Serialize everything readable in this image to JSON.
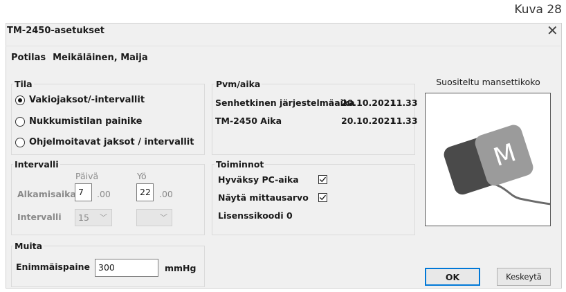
{
  "caption": "Kuva 28",
  "window": {
    "title": "TM-2450-asetukset"
  },
  "patient": {
    "label": "Potilas",
    "value": "Meikäläinen, Maija"
  },
  "tila": {
    "label": "Tila",
    "options": [
      {
        "label": "Vakiojaksot/-intervallit",
        "selected": true
      },
      {
        "label": "Nukkumistilan painike",
        "selected": false
      },
      {
        "label": "Ohjelmoitavat jaksot / intervallit",
        "selected": false
      }
    ]
  },
  "intervalli": {
    "label": "Intervalli",
    "col_day": "Päivä",
    "col_night": "Yö",
    "start_label": "Alkamisaika",
    "day_hour": "7",
    "day_suffix": ".00",
    "night_hour": "22",
    "night_suffix": ".00",
    "interval_label": "Intervalli",
    "day_interval": "15",
    "night_interval": ""
  },
  "muita": {
    "label": "Muita",
    "max_pressure_label": "Enimmäispaine",
    "max_pressure_value": "300",
    "unit": "mmHg"
  },
  "datetime": {
    "label": "Pvm/aika",
    "rows": [
      {
        "name": "Senhetkinen järjestelmäaika",
        "date": "20.10.2021",
        "time": "11.33"
      },
      {
        "name": "TM-2450 Aika",
        "date": "20.10.2021",
        "time": "11.33"
      }
    ]
  },
  "toiminnot": {
    "label": "Toiminnot",
    "accept_pc_time": {
      "label": "Hyväksy PC-aika",
      "checked": true
    },
    "show_value": {
      "label": "Näytä mittausarvo",
      "checked": true
    },
    "license": "Lisenssikoodi 0"
  },
  "cuff": {
    "label": "Suositeltu mansettikoko",
    "letter": "M"
  },
  "buttons": {
    "ok": "OK",
    "cancel": "Keskeytä"
  },
  "colors": {
    "accent": "#0078d7",
    "cuff_dark": "#4a4a4a",
    "cuff_light": "#9b9b9b"
  }
}
